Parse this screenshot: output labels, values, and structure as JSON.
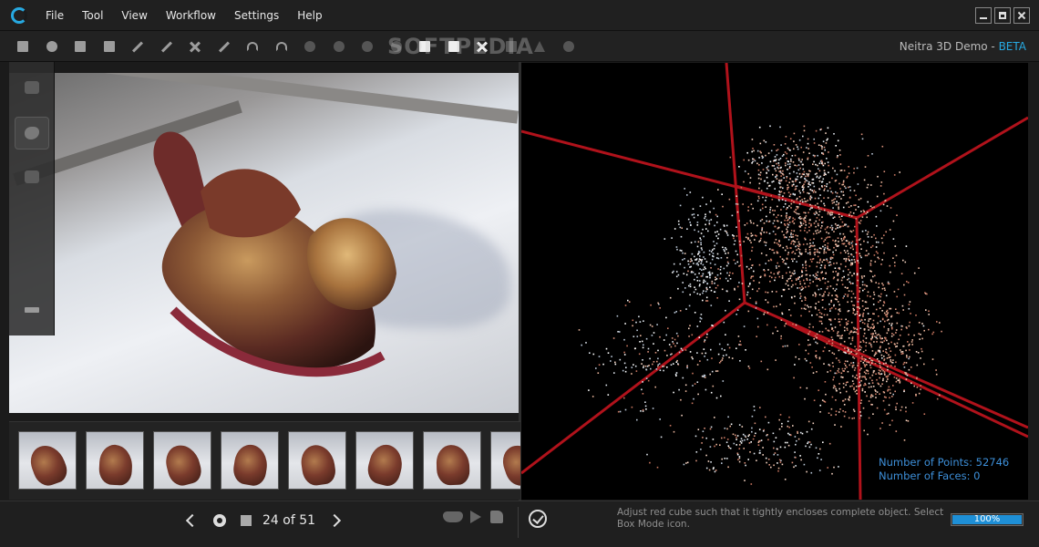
{
  "menu": {
    "items": [
      {
        "label": "File",
        "key": "F"
      },
      {
        "label": "Tool",
        "key": "T"
      },
      {
        "label": "View",
        "key": "V"
      },
      {
        "label": "Workflow",
        "key": "W"
      },
      {
        "label": "Settings",
        "key": "S"
      },
      {
        "label": "Help",
        "key": "H"
      }
    ]
  },
  "toolbar": {
    "watermark": "SOFTPEDIA",
    "brand_name": "Neitra 3D Demo - ",
    "brand_beta": "BETA",
    "icons": [
      "image-icon",
      "cloud-upload-icon",
      "unlock-icon",
      "fit-screen-icon",
      "brush-icon",
      "eyedropper-icon",
      "delete-x-icon",
      "eraser-icon",
      "undo-icon",
      "redo-icon",
      "cloud-icon",
      "cloud-icon",
      "rabbit-icon",
      "bird-icon",
      "cube-icon",
      "camera-icon",
      "cross-arrows-icon",
      "page-icon",
      "flame-icon",
      "pacman-icon"
    ]
  },
  "sidebar": {
    "icons": [
      "image-stack-icon",
      "object-icon",
      "mask-icon",
      "layout-icon"
    ]
  },
  "filmstrip": {
    "count": 8
  },
  "navigation": {
    "counter": "24 of 51"
  },
  "status": {
    "hint": "Adjust red cube such that it tightly encloses complete object. Select Box Mode icon.",
    "progress": 100,
    "progress_label": "100%"
  },
  "viewport": {
    "points_label": "Number of Points: 52746",
    "faces_label": "Number of Faces: 0",
    "cube_color": "#b0121b",
    "stats_color": "#3d8fd9"
  },
  "colors": {
    "accent": "#27a9e1",
    "progress_fill": "#1e8fd6"
  }
}
